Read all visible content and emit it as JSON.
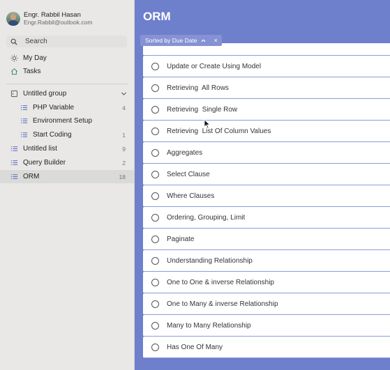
{
  "profile": {
    "name": "Engr. Rabbil Hasan",
    "email": "Engr.Rabbil@outlook.com"
  },
  "search": {
    "placeholder": "Search"
  },
  "nav": {
    "my_day": {
      "label": "My Day",
      "icon": "sun-icon"
    },
    "tasks": {
      "label": "Tasks",
      "icon": "home-icon"
    }
  },
  "lists": [
    {
      "label": "Untitled group",
      "icon": "group-icon",
      "count": ""
    },
    {
      "label": "PHP Variable",
      "icon": "list-icon",
      "count": "4"
    },
    {
      "label": "Environment Setup",
      "icon": "list-icon",
      "count": ""
    },
    {
      "label": "Start Coding",
      "icon": "list-icon",
      "count": "1"
    },
    {
      "label": "Untitled list",
      "icon": "list-icon",
      "count": "9"
    },
    {
      "label": "Query Builder",
      "icon": "list-icon",
      "count": "2"
    },
    {
      "label": "ORM",
      "icon": "list-icon",
      "count": "18"
    }
  ],
  "main": {
    "title": "ORM",
    "sort_chip": {
      "label": "Sorted by Due Date",
      "close": "×"
    },
    "tasks": [
      "Update or Create Using Model",
      "Retrieving  All Rows",
      "Retrieving  Single Row",
      "Retrieving  List Of Column Values",
      "Aggregates",
      "Select Clause",
      "Where Clauses",
      "Ordering, Grouping, Limit",
      "Paginate",
      "Understanding Relationship",
      "One to One & inverse Relationship",
      "One to Many & inverse Relationship",
      "Many to Many Relationship",
      "Has One Of Many"
    ]
  },
  "colors": {
    "accent": "#6e7fcc",
    "sidebar_bg": "#e9e8e6",
    "task_bg": "#ffffff"
  }
}
